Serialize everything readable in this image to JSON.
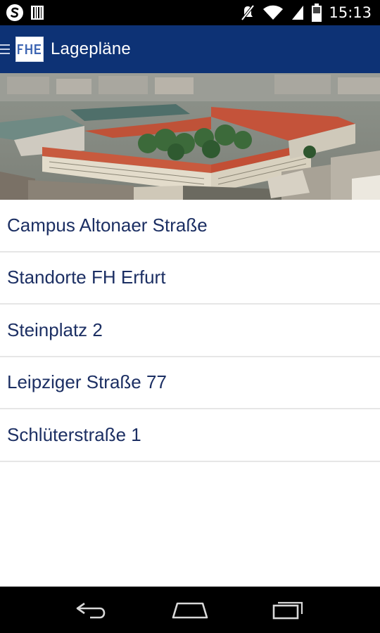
{
  "status_bar": {
    "time": "15:13",
    "icons": [
      "s-app-icon",
      "barcode-icon",
      "mute-icon",
      "wifi-icon",
      "signal-icon",
      "battery-icon"
    ]
  },
  "action_bar": {
    "title": "Lagepläne",
    "logo_text": "FHE",
    "background_color": "#0d3275"
  },
  "banner": {
    "description_icon": "campus-aerial-photo"
  },
  "locations": [
    {
      "label": "Campus Altonaer Straße"
    },
    {
      "label": "Standorte FH Erfurt"
    },
    {
      "label": "Steinplatz 2"
    },
    {
      "label": "Leipziger Straße 77"
    },
    {
      "label": "Schlüterstraße 1"
    }
  ],
  "nav_bar": {
    "buttons": [
      "back-icon",
      "home-icon",
      "recents-icon"
    ]
  },
  "colors": {
    "list_text": "#1c2f63",
    "divider": "#e6e6e6"
  }
}
